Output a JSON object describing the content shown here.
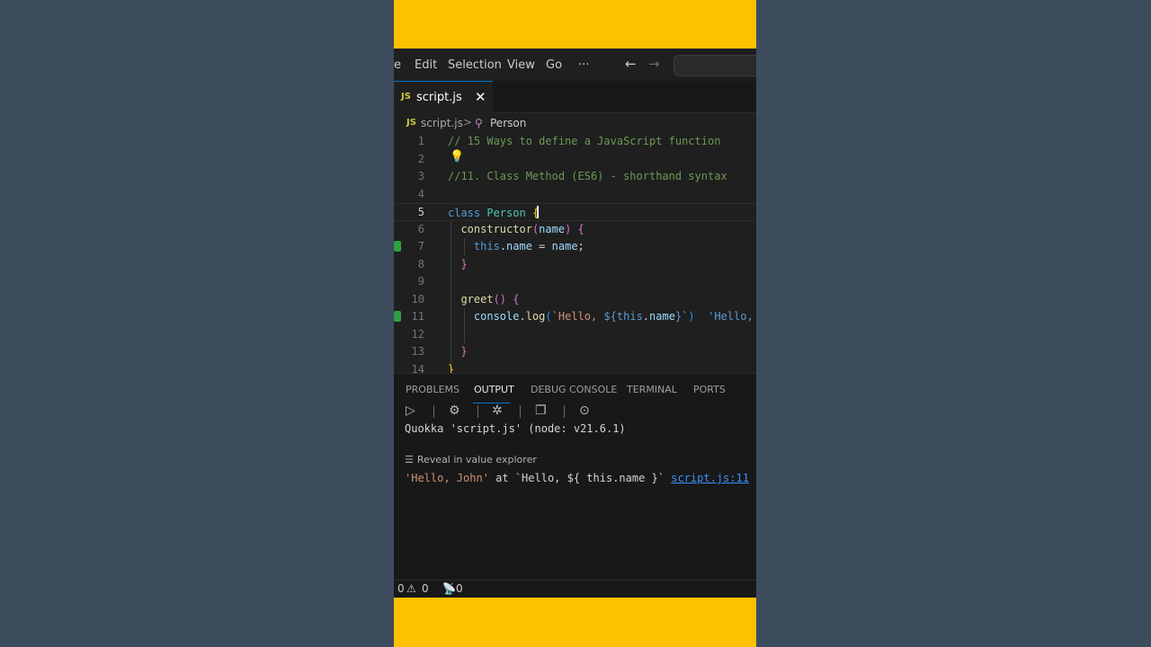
{
  "menubar": {
    "items": [
      "e",
      "Edit",
      "Selection",
      "View",
      "Go",
      "···"
    ],
    "back_icon": "arrow-left-icon",
    "forward_icon": "arrow-right-icon"
  },
  "tab": {
    "badge": "JS",
    "label": "script.js",
    "close": "✕"
  },
  "breadcrumb": {
    "badge": "JS",
    "file": "script.js",
    "separator": ">",
    "symbol": "Person"
  },
  "editor": {
    "line_numbers": [
      "1",
      "2",
      "3",
      "4",
      "5",
      "6",
      "7",
      "8",
      "9",
      "10",
      "11",
      "12",
      "13",
      "14"
    ],
    "active_line": "5"
  },
  "panel": {
    "tabs": [
      "PROBLEMS",
      "OUTPUT",
      "DEBUG CONSOLE",
      "TERMINAL",
      "PORTS"
    ],
    "active_tab": "OUTPUT",
    "quokka_line": "Quokka 'script.js' (node: v21.6.1)",
    "reveal_label": "Reveal in value explorer",
    "result_value": "'Hello, John'",
    "result_at": " at ",
    "result_expr": "`Hello, ${ this.name }`",
    "result_link": "script.js:11"
  },
  "statusbar": {
    "errors": "0",
    "warnings": "0",
    "ports": "0"
  },
  "colors": {
    "accent_yellow": "#fec100",
    "background": "#3c4c5d",
    "editor_bg": "#1f1f1f"
  }
}
